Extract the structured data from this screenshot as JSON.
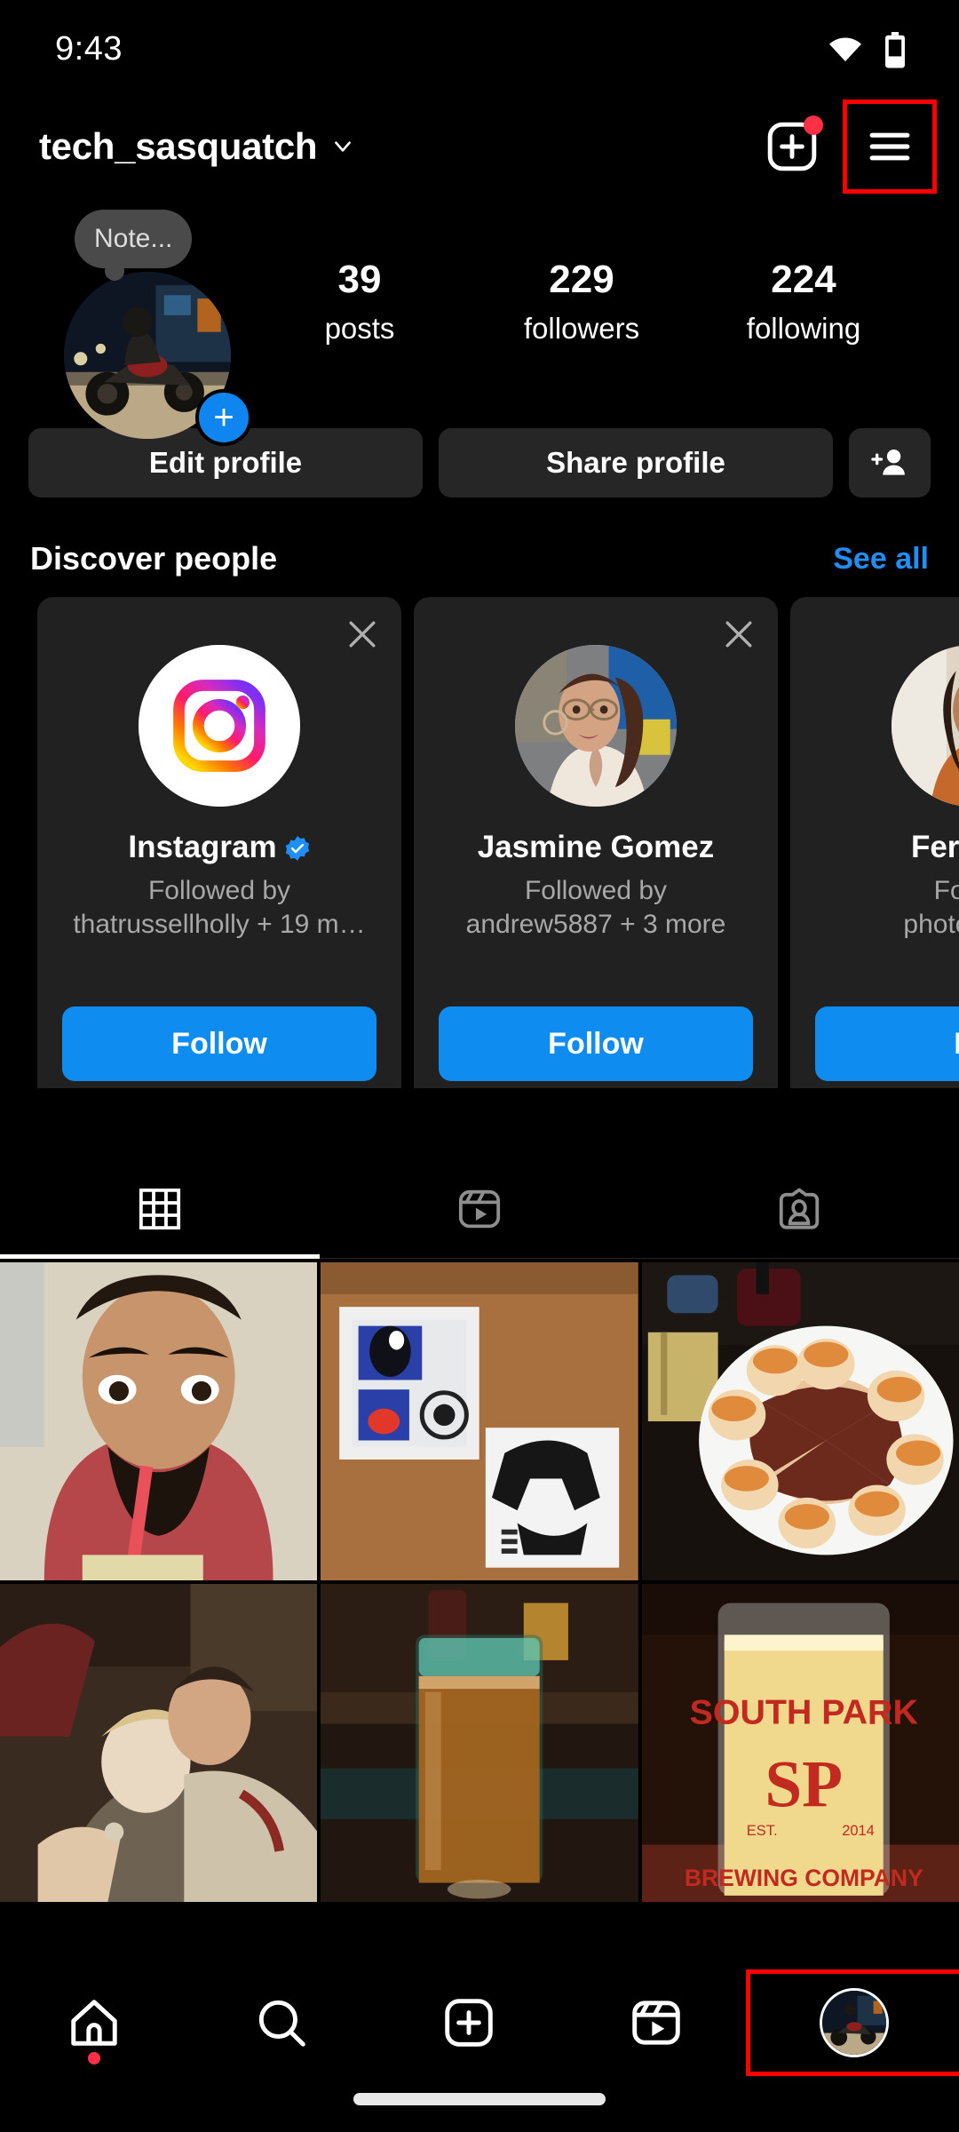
{
  "status_bar": {
    "time": "9:43",
    "wifi_icon": "wifi-icon",
    "battery_icon": "battery-icon"
  },
  "header": {
    "username": "tech_sasquatch",
    "chevron_icon": "chevron-down-icon",
    "new_post_icon": "new-post-plus-box-icon",
    "menu_icon": "hamburger-menu-icon",
    "menu_highlighted": "true",
    "notification_dot_color": "#ff2f45"
  },
  "profile": {
    "note_text": "Note...",
    "avatar_alt": "motorcycle-at-gas-station",
    "add_story_label": "+",
    "stats": [
      {
        "value": "39",
        "label": "posts"
      },
      {
        "value": "229",
        "label": "followers"
      },
      {
        "value": "224",
        "label": "following"
      }
    ]
  },
  "actions": {
    "edit_profile": "Edit profile",
    "share_profile": "Share profile",
    "add_person_icon": "add-person-icon"
  },
  "discover": {
    "title": "Discover people",
    "see_all": "See all",
    "cards": [
      {
        "name": "Instagram",
        "verified": true,
        "subtitle_line1": "Followed by",
        "subtitle_line2": "thatrussellholly + 19 m…",
        "follow_label": "Follow",
        "avatar_alt": "instagram-logo"
      },
      {
        "name": "Jasmine Gomez",
        "verified": false,
        "subtitle_line1": "Followed by",
        "subtitle_line2": "andrew5887 + 3 more",
        "follow_label": "Follow",
        "avatar_alt": "woman-with-glasses-selfie"
      },
      {
        "name": "Fernand",
        "verified": false,
        "subtitle_line1": "Follow",
        "subtitle_line2": "photosasqu",
        "follow_label": "Fo",
        "avatar_alt": "woman-in-orange-top"
      }
    ],
    "close_icon": "close-x-icon"
  },
  "tabs": {
    "items": [
      {
        "icon": "grid-icon",
        "name": "posts-grid-tab",
        "active": true
      },
      {
        "icon": "reels-icon",
        "name": "reels-tab",
        "active": false
      },
      {
        "icon": "tagged-icon",
        "name": "tagged-tab",
        "active": false
      }
    ]
  },
  "grid": {
    "posts": [
      {
        "alt": "selfie-man-drinking-through-straw"
      },
      {
        "alt": "star-wars-r2d2-and-stormtrooper-prints"
      },
      {
        "alt": "sushi-roll-plate-with-sauce-design"
      },
      {
        "alt": "movie-scene-couple-embracing"
      },
      {
        "alt": "glass-of-beer-on-bar"
      },
      {
        "alt": "south-park-brewing-company-beer-glass"
      }
    ]
  },
  "bottom_nav": {
    "items": [
      {
        "icon": "home-icon",
        "name": "nav-home",
        "badge": true
      },
      {
        "icon": "search-icon",
        "name": "nav-search",
        "badge": false
      },
      {
        "icon": "create-icon",
        "name": "nav-create",
        "badge": false
      },
      {
        "icon": "reels-icon",
        "name": "nav-reels",
        "badge": false
      },
      {
        "icon": "profile-avatar",
        "name": "nav-profile",
        "badge": false,
        "highlighted": true
      }
    ]
  },
  "colors": {
    "accent_blue": "#0f8cf0",
    "link_blue": "#1f8ff5",
    "card_bg": "#212121",
    "button_bg": "#262626",
    "highlight_red": "#ff0000",
    "notification_red": "#ff2f45"
  }
}
